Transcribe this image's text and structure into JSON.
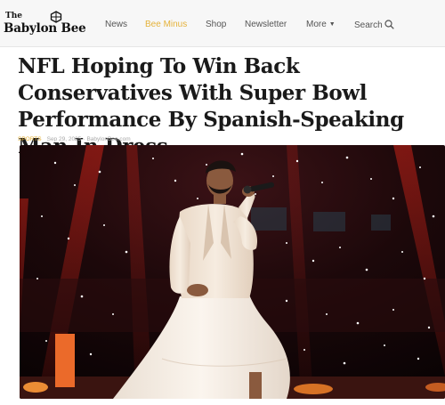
{
  "site": {
    "logo_top": "The",
    "logo_name": "Babylon Bee"
  },
  "nav": {
    "items": [
      {
        "label": "News"
      },
      {
        "label": "Bee Minus"
      },
      {
        "label": "Shop"
      },
      {
        "label": "Newsletter"
      },
      {
        "label": "More"
      },
      {
        "label": "Search"
      }
    ]
  },
  "article": {
    "title": "NFL Hoping To Win Back Conservatives With Super Bowl Performance By Spanish-Speaking Man In Dress",
    "category": "SPORTS",
    "date": "Sep 29, 2025",
    "source": "BabylonBee.com"
  },
  "colors": {
    "accent": "#e5b23a",
    "stage_red": "#c81a10",
    "background": "#ffffff"
  }
}
